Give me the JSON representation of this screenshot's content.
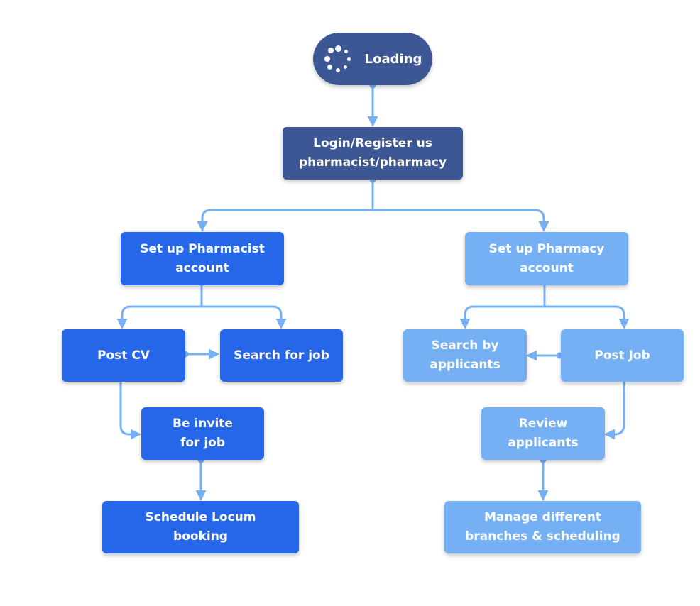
{
  "diagram": {
    "colors": {
      "navy": "#3d5794",
      "pharmacist_blue": "#2567e8",
      "pharmacy_light_blue": "#75b0f4",
      "connector": "#75b0f4"
    },
    "nodes": {
      "loading": {
        "label": "Loading",
        "icon": "spinner-icon"
      },
      "login": {
        "label": "Login/Register us\npharmacist/pharmacy"
      },
      "pharmacist_setup": {
        "label": "Set up Pharmacist\naccount"
      },
      "pharmacy_setup": {
        "label": "Set up Pharmacy\naccount"
      },
      "post_cv": {
        "label": "Post CV"
      },
      "search_job": {
        "label": "Search for job"
      },
      "be_invited": {
        "label": "Be invite\nfor job"
      },
      "schedule_locum": {
        "label": "Schedule Locum\nbooking"
      },
      "search_applicants": {
        "label": "Search by\napplicants"
      },
      "post_job": {
        "label": "Post Job"
      },
      "review_applicants": {
        "label": "Review\napplicants"
      },
      "manage_branches": {
        "label": "Manage different\nbranches &  scheduling"
      }
    },
    "edges": [
      {
        "from": "loading",
        "to": "login"
      },
      {
        "from": "login",
        "to": "pharmacist_setup"
      },
      {
        "from": "login",
        "to": "pharmacy_setup"
      },
      {
        "from": "pharmacist_setup",
        "to": "post_cv"
      },
      {
        "from": "pharmacist_setup",
        "to": "search_job"
      },
      {
        "from": "post_cv",
        "to": "search_job"
      },
      {
        "from": "post_cv",
        "to": "be_invited"
      },
      {
        "from": "be_invited",
        "to": "schedule_locum"
      },
      {
        "from": "pharmacy_setup",
        "to": "search_applicants"
      },
      {
        "from": "pharmacy_setup",
        "to": "post_job"
      },
      {
        "from": "post_job",
        "to": "search_applicants"
      },
      {
        "from": "post_job",
        "to": "review_applicants"
      },
      {
        "from": "review_applicants",
        "to": "manage_branches"
      }
    ]
  }
}
